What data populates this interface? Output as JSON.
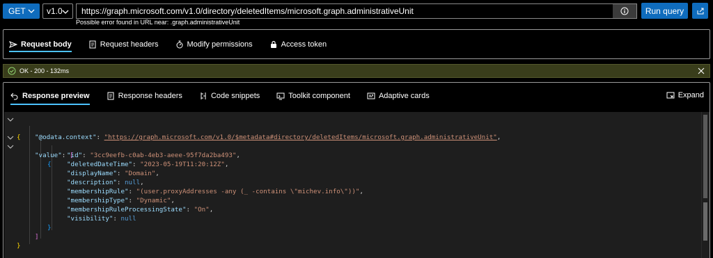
{
  "topbar": {
    "method": "GET",
    "version": "v1.0",
    "url": "https://graph.microsoft.com/v1.0/directory/deletedItems/microsoft.graph.administrativeUnit",
    "url_hint": "Possible error found in URL near: .graph.administrativeUnit",
    "run_label": "Run query"
  },
  "request_tabs": [
    {
      "label": "Request body",
      "icon": "send-icon",
      "active": true
    },
    {
      "label": "Request headers",
      "icon": "headers-doc-icon",
      "active": false
    },
    {
      "label": "Modify permissions",
      "icon": "permissions-icon",
      "active": false
    },
    {
      "label": "Access token",
      "icon": "lock-icon",
      "active": false
    }
  ],
  "status": {
    "text": "OK - 200 - 132ms",
    "color": "#393d1b"
  },
  "response_tabs": [
    {
      "label": "Response preview",
      "icon": "undo-arrow-icon",
      "active": true
    },
    {
      "label": "Response headers",
      "icon": "headers-doc-icon",
      "active": false
    },
    {
      "label": "Code snippets",
      "icon": "code-snippets-icon",
      "active": false
    },
    {
      "label": "Toolkit component",
      "icon": "toolkit-icon",
      "active": false
    },
    {
      "label": "Adaptive cards",
      "icon": "adaptive-card-icon",
      "active": false
    }
  ],
  "expand_label": "Expand",
  "json": {
    "context_key": "\"@odata.context\"",
    "context_val": "\"https://graph.microsoft.com/v1.0/$metadata#directory/deletedItems/microsoft.graph.administrativeUnit\"",
    "value_key": "\"value\"",
    "fields": [
      {
        "key": "\"id\"",
        "val": "\"3cc9eefb-c0ab-4eb3-aeee-95f7da2ba493\"",
        "type": "string",
        "comma": true
      },
      {
        "key": "\"deletedDateTime\"",
        "val": "\"2023-05-19T11:20:12Z\"",
        "type": "string",
        "comma": true
      },
      {
        "key": "\"displayName\"",
        "val": "\"Domain\"",
        "type": "string",
        "comma": true
      },
      {
        "key": "\"description\"",
        "val": "null",
        "type": "null",
        "comma": true
      },
      {
        "key": "\"membershipRule\"",
        "val": "\"(user.proxyAddresses -any (_ -contains \\\"michev.info\\\"))\"",
        "type": "string",
        "comma": true
      },
      {
        "key": "\"membershipType\"",
        "val": "\"Dynamic\"",
        "type": "string",
        "comma": true
      },
      {
        "key": "\"membershipRuleProcessingState\"",
        "val": "\"On\"",
        "type": "string",
        "comma": true
      },
      {
        "key": "\"visibility\"",
        "val": "null",
        "type": "null",
        "comma": false
      }
    ]
  },
  "colors": {
    "accent": "#0f6cbd",
    "tab_underline": "#4cc2ff",
    "editor_bg": "#1e1e1e",
    "json_key": "#9cdcfe",
    "json_string": "#ce9178",
    "json_null": "#569cd6"
  }
}
